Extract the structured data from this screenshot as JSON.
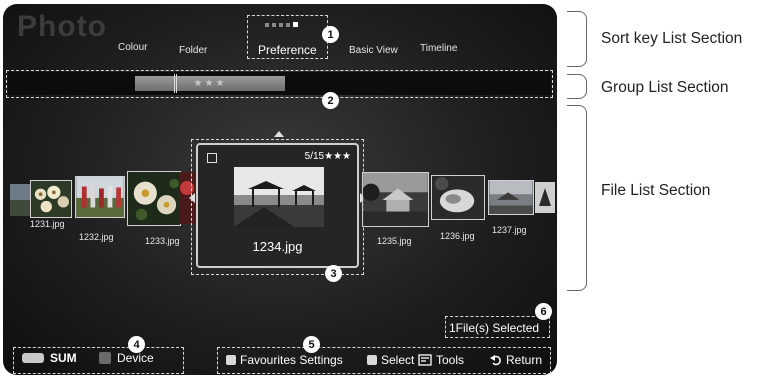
{
  "screen": {
    "title": "Photo",
    "sort_keys": {
      "colour": "Colour",
      "folder": "Folder",
      "preference": "Preference",
      "basic_view": "Basic View",
      "timeline": "Timeline"
    },
    "group": {
      "stars": "★★★"
    },
    "files": [
      {
        "name": "1231.jpg"
      },
      {
        "name": "1232.jpg"
      },
      {
        "name": "1233.jpg"
      },
      {
        "name": "1234.jpg"
      },
      {
        "name": "1235.jpg"
      },
      {
        "name": "1236.jpg"
      },
      {
        "name": "1237.jpg"
      }
    ],
    "focused": {
      "name": "1234.jpg",
      "rating": "5/15★★★"
    },
    "selected_count": "1File(s) Selected",
    "device_buttons": {
      "sum": "SUM",
      "device": "Device"
    },
    "hints": {
      "favourites": "Favourites Settings",
      "select": "Select",
      "tools": "Tools",
      "return": "Return"
    }
  },
  "badges": {
    "b1": "1",
    "b2": "2",
    "b3": "3",
    "b4": "4",
    "b5": "5",
    "b6": "6"
  },
  "callouts": {
    "sort_key": "Sort key List Section",
    "group": "Group List Section",
    "file": "File List Section"
  },
  "colors": {
    "background": "#1f1f1f",
    "highlight": "#8a8a8a",
    "text": "#ffffff"
  }
}
